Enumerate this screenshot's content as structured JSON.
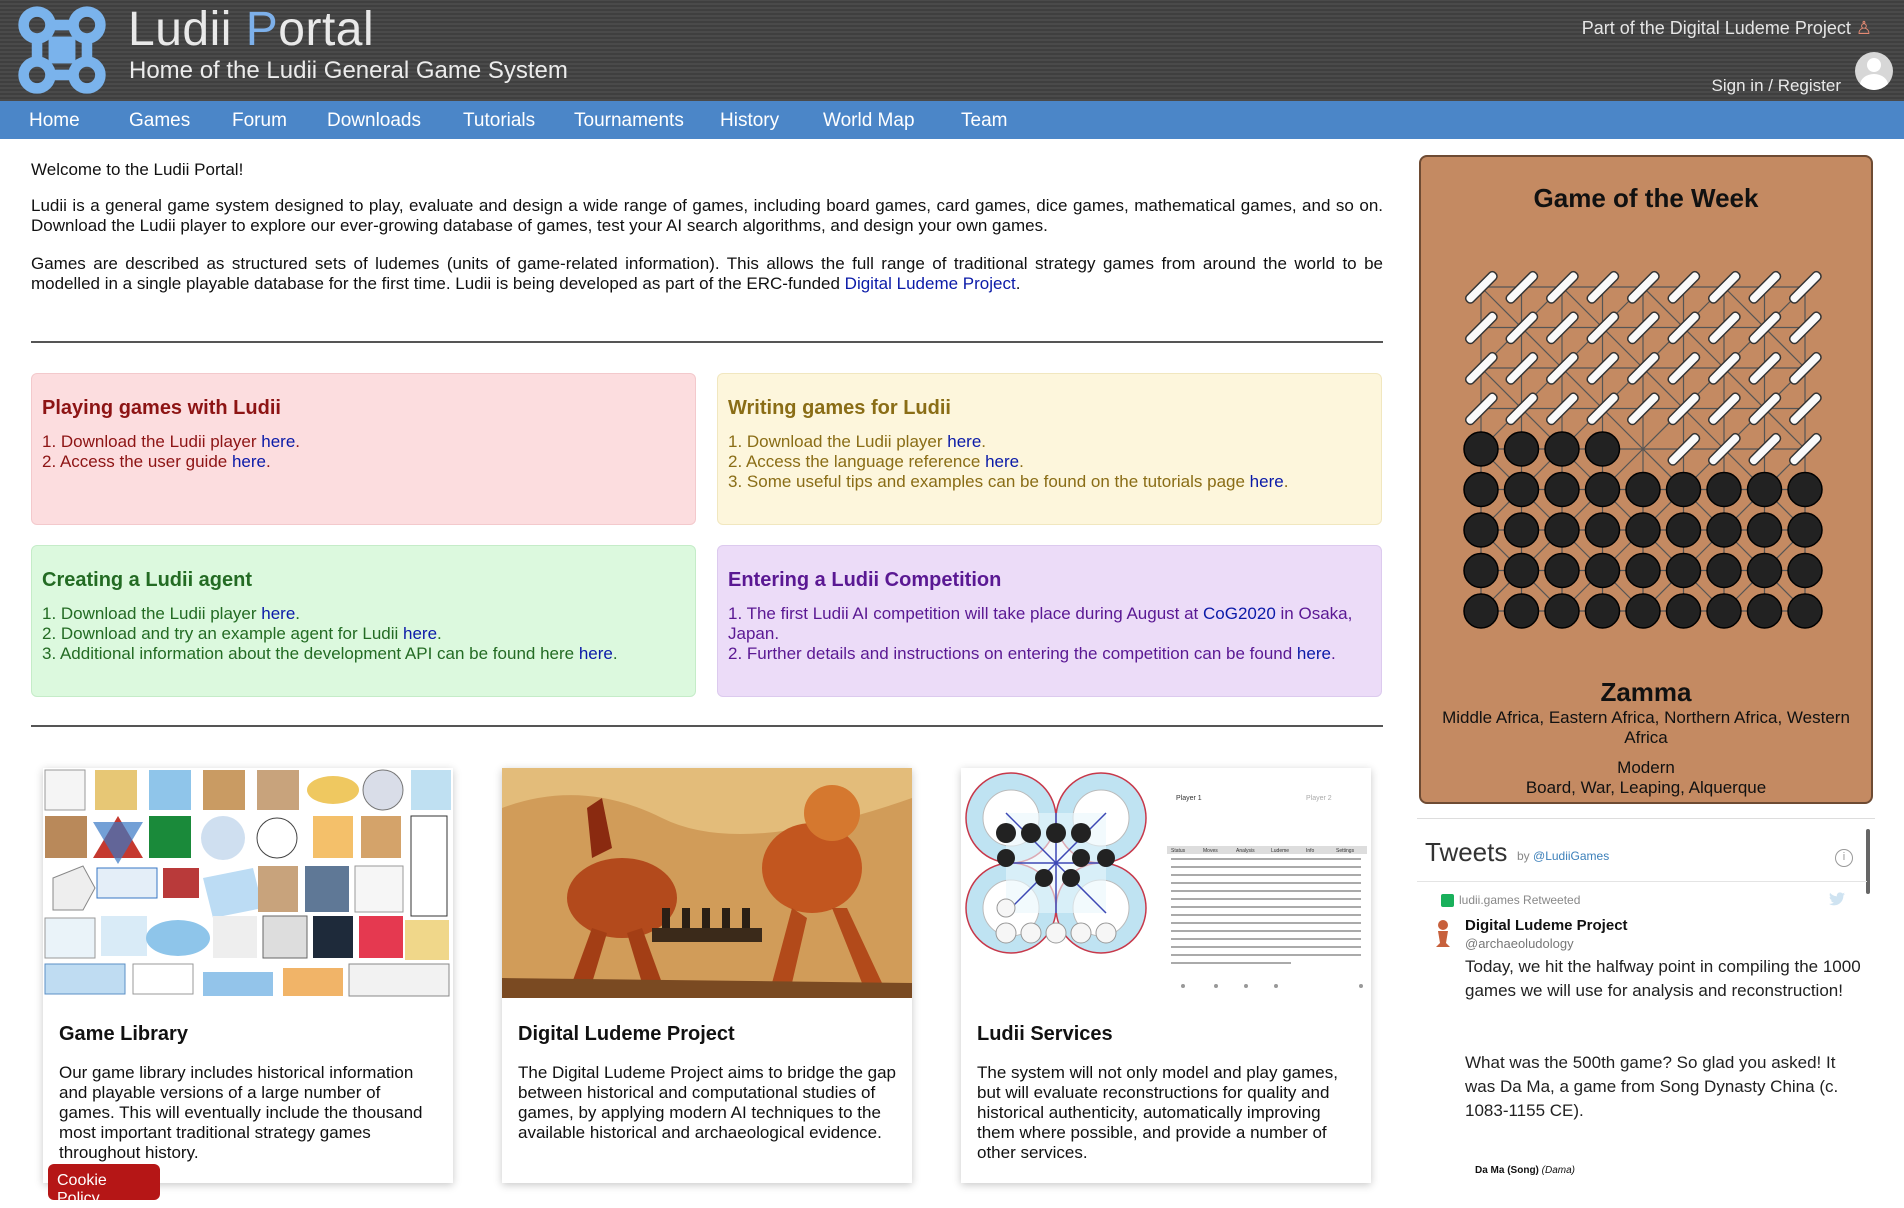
{
  "header": {
    "title_main": "Ludii ",
    "title_accent": "P",
    "title_rest": "ortal",
    "subtitle": "Home of the Ludii General Game System",
    "dlp_link": "Part of the Digital Ludeme Project",
    "signin": "Sign in / Register"
  },
  "nav": [
    "Home",
    "Games",
    "Forum",
    "Downloads",
    "Tutorials",
    "Tournaments",
    "History",
    "World Map",
    "Team"
  ],
  "intro": {
    "welcome": "Welcome to the Ludii Portal!",
    "p1": "Ludii is a general game system designed to play, evaluate and design a wide range of games, including board games, card games, dice games, mathematical games, and so on. Download the Ludii player to explore our ever-growing database of games, test your AI search algorithms, and design your own games.",
    "p2_text": "Games are described as structured sets of ludemes (units of game-related information). This allows the full range of traditional strategy games from around the world to be modelled in a single playable database for the first time. Ludii is being developed as part of the ERC-funded ",
    "p2_link": "Digital Ludeme Project",
    "p2_end": "."
  },
  "boxes": {
    "play": {
      "title": "Playing games with Ludii",
      "items": [
        {
          "text": "1. Download the Ludii player ",
          "link": "here",
          "end": "."
        },
        {
          "text": "2. Access the user guide ",
          "link": "here",
          "end": "."
        }
      ]
    },
    "write": {
      "title": "Writing games for Ludii",
      "items": [
        {
          "text": "1. Download the Ludii player ",
          "link": "here",
          "end": "."
        },
        {
          "text": "2. Access the language reference ",
          "link": "here",
          "end": "."
        },
        {
          "text": "3. Some useful tips and examples can be found on the tutorials page ",
          "link": "here",
          "end": "."
        }
      ]
    },
    "agent": {
      "title": "Creating a Ludii agent",
      "items": [
        {
          "text": "1. Download the Ludii player ",
          "link": "here",
          "end": "."
        },
        {
          "text": "2. Download and try an example agent for Ludii ",
          "link": "here",
          "end": "."
        },
        {
          "text": "3. Additional information about the development API can be found here ",
          "link": "here",
          "end": "."
        }
      ]
    },
    "comp": {
      "title": "Entering a Ludii Competition",
      "items": [
        {
          "text": "1. The first Ludii AI competition will take place during August at ",
          "link": "CoG2020",
          "end": " in Osaka, Japan."
        },
        {
          "text": "2. Further details and instructions on entering the competition can be found ",
          "link": "here",
          "end": "."
        }
      ]
    }
  },
  "cards": [
    {
      "title": "Game Library",
      "text": "Our game library includes historical information and playable versions of a large number of games. This will eventually include the thousand most important traditional strategy games throughout history."
    },
    {
      "title": "Digital Ludeme Project",
      "text": "The Digital Ludeme Project aims to bridge the gap between historical and computational studies of games, by applying modern AI techniques to the available historical and archaeological evidence."
    },
    {
      "title": "Ludii Services",
      "text": "The system will not only model and play games, but will evaluate reconstructions for quality and historical authenticity, automatically improving them where possible, and provide a number of other services."
    }
  ],
  "services_img": {
    "player1": "Player 1",
    "player2": "Player 2",
    "tabs": [
      "Status",
      "Moves",
      "Analysis",
      "Ludeme",
      "Info",
      "Settings"
    ]
  },
  "cookie": "Cookie Policy",
  "gotw": {
    "title": "Game of the Week",
    "name": "Zamma",
    "regions": "Middle Africa, Eastern Africa, Northern Africa, Western Africa",
    "period": "Modern",
    "categories": "Board, War, Leaping, Alquerque"
  },
  "tweets": {
    "title": "Tweets",
    "by": "by ",
    "handle_link": "@LudiiGames",
    "retweeted": "ludii.games Retweeted",
    "author": "Digital Ludeme Project",
    "author_handle": "@archaeoludology",
    "text1": "Today, we hit the halfway point in compiling the 1000 games we will use for analysis and reconstruction!",
    "text2": "What was the 500th game? So glad you asked! It was Da Ma, a game from Song Dynasty China (c. 1083-1155 CE).",
    "game_caption": "Da Ma (Song) ",
    "game_caption_italic": "(Dama)"
  },
  "colors": {
    "nav": "#4b86c8",
    "gotw_bg": "#c48a62",
    "play_box": "#fcdddf",
    "write_box": "#fdf6dc",
    "agent_box": "#dcf9de",
    "comp_box": "#ecdcf8",
    "link": "#0a1aa8"
  }
}
